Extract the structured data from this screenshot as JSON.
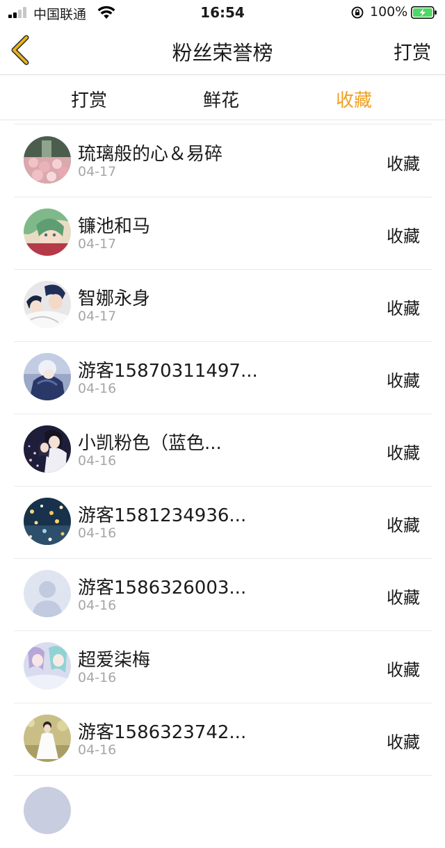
{
  "status_bar": {
    "carrier": "中国联通",
    "time": "16:54",
    "battery_percent": "100%"
  },
  "nav": {
    "title": "粉丝荣誉榜",
    "action_label": "打赏"
  },
  "tabs": [
    {
      "label": "打赏",
      "active": false
    },
    {
      "label": "鲜花",
      "active": false
    },
    {
      "label": "收藏",
      "active": true
    }
  ],
  "colors": {
    "accent": "#f0a022",
    "text": "#1a1a1a",
    "muted": "#a6a6a6",
    "back_icon": "#e7b51b"
  },
  "list": [
    {
      "name": "琉璃般的心＆易碎",
      "date": "04-17",
      "action": "收藏",
      "avatar": "avatar-flowers"
    },
    {
      "name": "镰池和马",
      "date": "04-17",
      "action": "收藏",
      "avatar": "avatar-anime-girl"
    },
    {
      "name": "智娜永身",
      "date": "04-17",
      "action": "收藏",
      "avatar": "avatar-anime-couple"
    },
    {
      "name": "游客15870311497...",
      "date": "04-16",
      "action": "收藏",
      "avatar": "avatar-anime-blue"
    },
    {
      "name": "小凯粉色（蓝色...",
      "date": "04-16",
      "action": "收藏",
      "avatar": "avatar-couple-night"
    },
    {
      "name": "游客1581234936...",
      "date": "04-16",
      "action": "收藏",
      "avatar": "avatar-city-lights"
    },
    {
      "name": "游客1586326003...",
      "date": "04-16",
      "action": "收藏",
      "avatar": "avatar-default-person"
    },
    {
      "name": "超爱柒梅",
      "date": "04-16",
      "action": "收藏",
      "avatar": "avatar-anime-pastel"
    },
    {
      "name": "游客1586323742...",
      "date": "04-16",
      "action": "收藏",
      "avatar": "avatar-girl-white-dress"
    }
  ]
}
